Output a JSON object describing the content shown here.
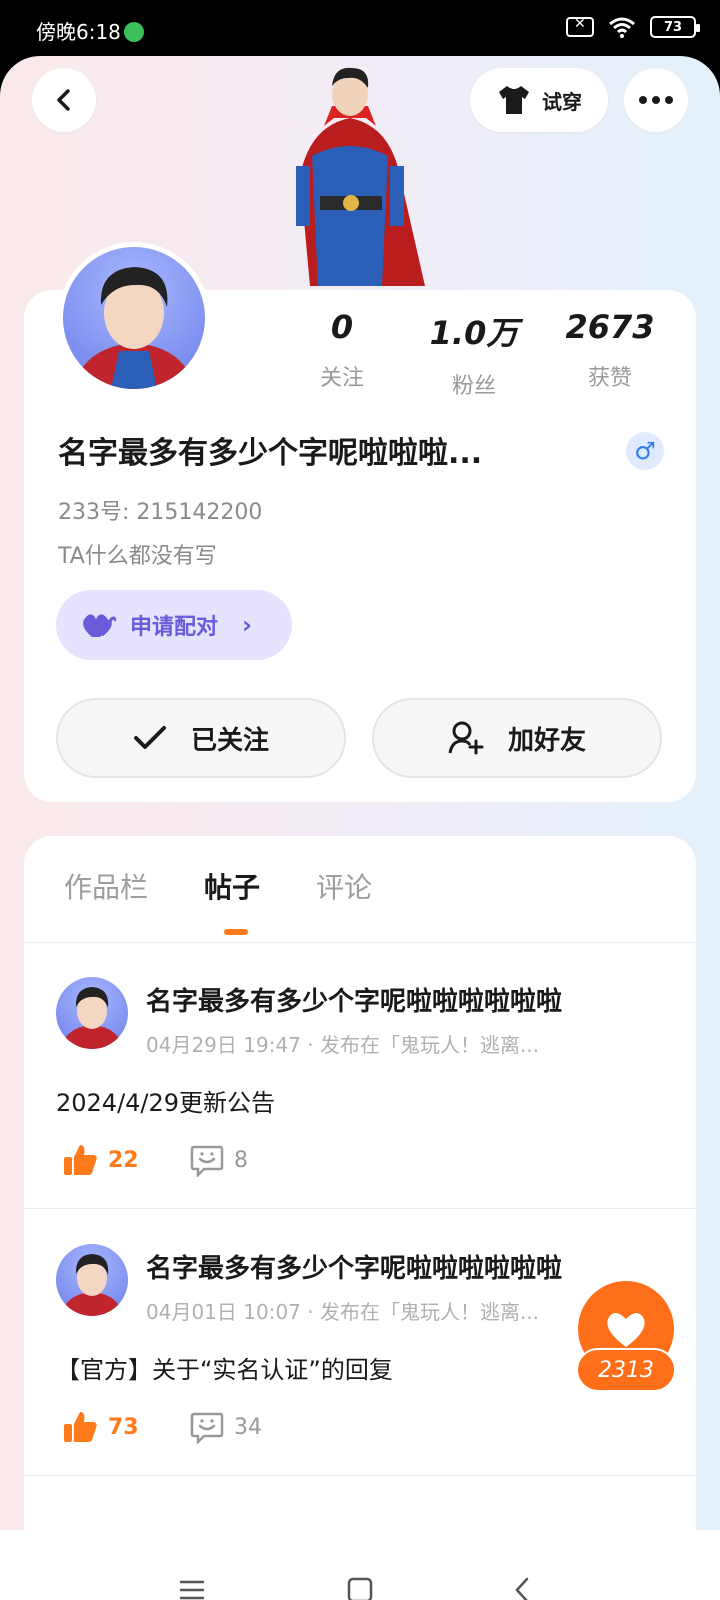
{
  "status_bar": {
    "time": "傍晚6:18",
    "battery": "73"
  },
  "top": {
    "try_on_label": "试穿"
  },
  "stats": [
    {
      "value": "0",
      "label": "关注"
    },
    {
      "value": "1.0万",
      "label": "粉丝"
    },
    {
      "value": "2673",
      "label": "获赞"
    }
  ],
  "profile": {
    "username": "名字最多有多少个字呢啦啦啦...",
    "gender_symbol": "♂",
    "uid": "233号: 215142200",
    "bio": "TA什么都没有写",
    "pair_label": "申请配对",
    "follow_label": "已关注",
    "add_friend_label": "加好友"
  },
  "tabs": [
    {
      "label": "作品栏",
      "active": false
    },
    {
      "label": "帖子",
      "active": true
    },
    {
      "label": "评论",
      "active": false
    }
  ],
  "posts": [
    {
      "author": "名字最多有多少个字呢啦啦啦啦啦啦",
      "meta": "04月29日 19:47 · 发布在「鬼玩人！逃离...",
      "content": "2024/4/29更新公告",
      "likes": "22",
      "comments": "8"
    },
    {
      "author": "名字最多有多少个字呢啦啦啦啦啦啦",
      "meta": "04月01日 10:07 · 发布在「鬼玩人！逃离...",
      "content": "【官方】关于“实名认证”的回复",
      "likes": "73",
      "comments": "34"
    }
  ],
  "fab": {
    "count": "2313"
  },
  "colors": {
    "accent_orange": "#ff6f1a",
    "pair_purple": "#6b5ad9",
    "gender_blue": "#2f7bf0"
  }
}
